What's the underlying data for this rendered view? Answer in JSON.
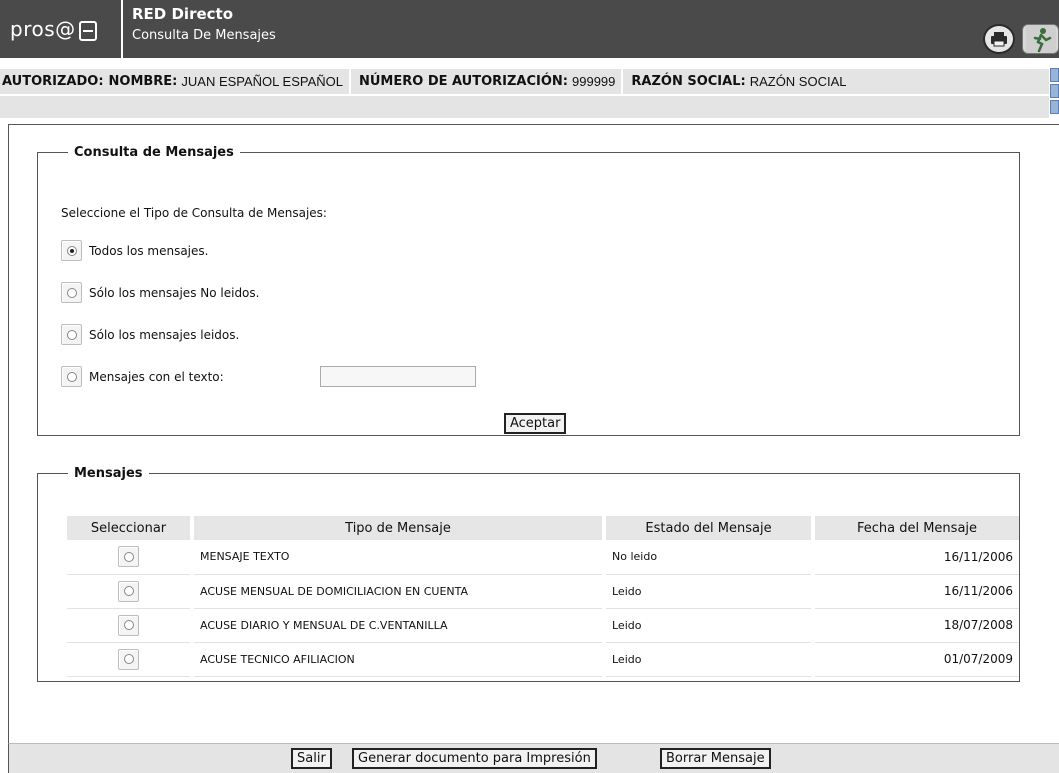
{
  "header": {
    "logo_text": "pros@",
    "app_title": "RED Directo",
    "subtitle": "Consulta De Mensajes",
    "print_icon": "printer-icon",
    "exit_icon": "exit-running-man-icon"
  },
  "infobar": {
    "autorizado_label": "AUTORIZADO:",
    "nombre_label": "NOMBRE:",
    "nombre_value": "JUAN ESPAÑOL ESPAÑOL",
    "numero_label": "NÚMERO DE AUTORIZACIÓN:",
    "numero_value": "999999",
    "razon_label": "RAZÓN SOCIAL:",
    "razon_value": "RAZÓN SOCIAL"
  },
  "consulta": {
    "legend": "Consulta de Mensajes",
    "prompt": "Seleccione el Tipo de Consulta de Mensajes:",
    "options": [
      {
        "label": "Todos los mensajes.",
        "checked": true
      },
      {
        "label": "Sólo los mensajes No leidos.",
        "checked": false
      },
      {
        "label": "Sólo los mensajes leidos.",
        "checked": false
      },
      {
        "label": "Mensajes con el texto:",
        "checked": false
      }
    ],
    "text_value": "",
    "accept_label": "Aceptar"
  },
  "mensajes": {
    "legend": "Mensajes",
    "columns": [
      "Seleccionar",
      "Tipo de Mensaje",
      "Estado del Mensaje",
      "Fecha del Mensaje"
    ],
    "rows": [
      {
        "tipo": "MENSAJE TEXTO",
        "estado": "No leido",
        "fecha": "16/11/2006"
      },
      {
        "tipo": "ACUSE MENSUAL DE DOMICILIACION EN CUENTA",
        "estado": "Leido",
        "fecha": "16/11/2006"
      },
      {
        "tipo": "ACUSE DIARIO Y MENSUAL DE C.VENTANILLA",
        "estado": "Leido",
        "fecha": "18/07/2008"
      },
      {
        "tipo": "ACUSE TECNICO AFILIACION",
        "estado": "Leido",
        "fecha": "01/07/2009"
      }
    ]
  },
  "footer": {
    "salir": "Salir",
    "generar": "Generar documento para Impresión",
    "borrar": "Borrar Mensaje"
  }
}
